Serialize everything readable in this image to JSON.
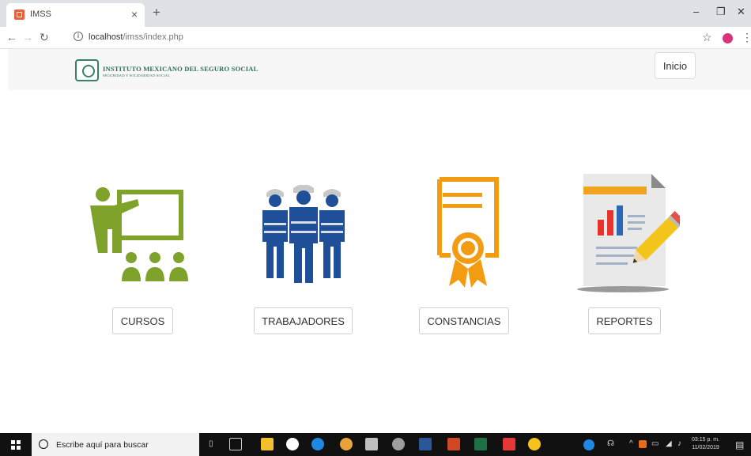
{
  "browser": {
    "tab_title": "IMSS",
    "tab_close": "×",
    "new_tab": "+",
    "url_host": "localhost",
    "url_path": "/imss/index.php",
    "minimize": "–",
    "restore": "❐",
    "close": "✕"
  },
  "header": {
    "org_name": "INSTITUTO MEXICANO DEL SEGURO SOCIAL",
    "org_tagline": "SEGURIDAD Y SOLIDARIDAD SOCIAL",
    "inicio_label": "Inicio"
  },
  "tiles": [
    {
      "label": "CURSOS",
      "icon": "teacher-classroom-icon",
      "color": "#7ea22a"
    },
    {
      "label": "TRABAJADORES",
      "icon": "workers-icon",
      "color": "#1f4f99"
    },
    {
      "label": "CONSTANCIAS",
      "icon": "certificate-icon",
      "color": "#f39c12"
    },
    {
      "label": "REPORTES",
      "icon": "report-chart-icon",
      "color": "#e6a817"
    }
  ],
  "taskbar": {
    "search_placeholder": "Escribe aquí para buscar",
    "time": "03:15 p. m.",
    "date": "11/02/2019"
  }
}
